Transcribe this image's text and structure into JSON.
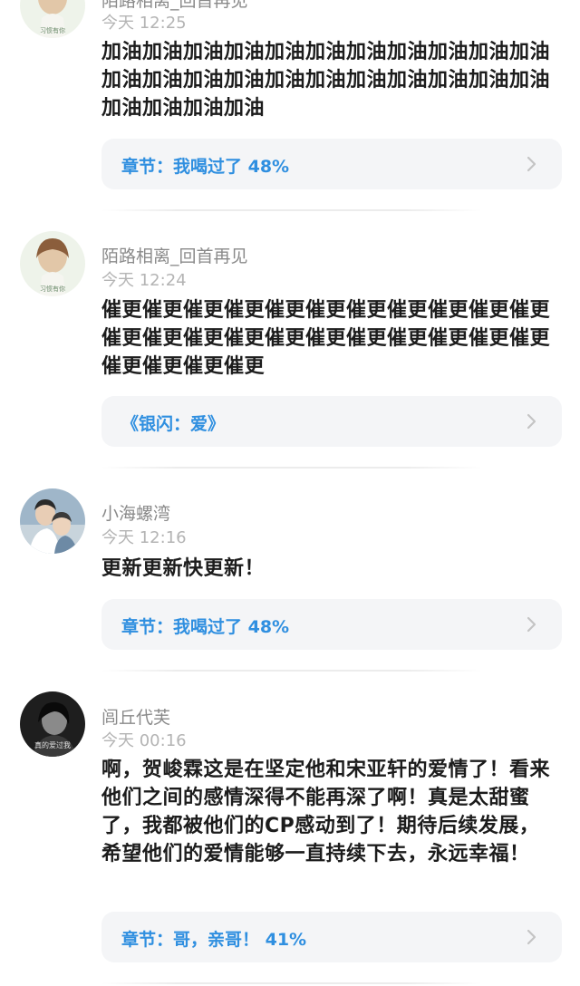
{
  "comments": [
    {
      "username": "陌路相离_回首再见",
      "time": "今天 12:25",
      "text": "加油加油加油加油加油加油加油加油加油加油加油加油加油加油加油加油加油加油加油加油加油加油加油加油加油加油",
      "chapter": "章节：我喝过了 48%",
      "avatar_icon": "girl-illustration-avatar"
    },
    {
      "username": "陌路相离_回首再见",
      "time": "今天 12:24",
      "text": "催更催更催更催更催更催更催更催更催更催更催更催更催更催更催更催更催更催更催更催更催更催更催更催更催更催更",
      "chapter": "《银闪：爱》",
      "avatar_icon": "girl-illustration-avatar"
    },
    {
      "username": "小海螺湾",
      "time": "今天 12:16",
      "text": "更新更新快更新！",
      "chapter": "章节：我喝过了 48%",
      "avatar_icon": "couple-photo-avatar"
    },
    {
      "username": "闾丘代芙",
      "time": "今天 00:16",
      "text": "啊，贺峻霖这是在坚定他和宋亚轩的爱情了！看来他们之间的感情深得不能再深了啊！真是太甜蜜了，我都被他们的CP感动到了！期待后续发展，希望他们的爱情能够一直持续下去，永远幸福！",
      "chapter": "章节：哥，亲哥！ 41%",
      "avatar_icon": "bw-portrait-avatar",
      "avatar_text": "真的爱过我"
    }
  ],
  "colors": {
    "accent": "#2f8fe0",
    "username": "#8a8a8a",
    "time": "#b4b4b4",
    "card_bg": "#f4f5f7",
    "text": "#1c1c1c"
  }
}
